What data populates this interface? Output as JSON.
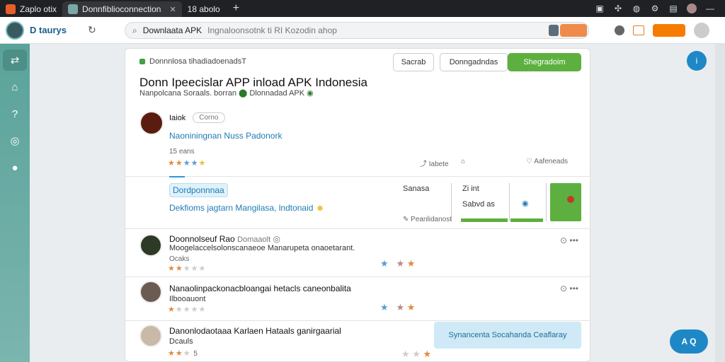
{
  "tabs": [
    {
      "label": "Zaplo otix",
      "active": false
    },
    {
      "label": "Donnfiblioconnection",
      "active": true
    },
    {
      "label": "18 abolo",
      "active": false
    }
  ],
  "toolbar": {
    "app_name": "D taurys",
    "omnibox_query": "Downlaata APK",
    "omnibox_rest": "Ingnaloonsotnk ti RI Kozodin ahop"
  },
  "breadcrumb": "Donnnlosa tihadiadoenadsT",
  "buttons": {
    "secondary": "Sacrab",
    "outline": "Donngadndas",
    "primary": "Shegradoim"
  },
  "title": "Donn Ipeecislar APP inload APK Indonesia",
  "subtitle": "Nanpolcana Soraals. borran",
  "subtitle_link": "Dlonnadad APK",
  "author": {
    "name": "Iaiok",
    "chip": "Corno",
    "link": "Naoniningnan Nuss Padonork",
    "count": "15 eans"
  },
  "actions": {
    "share": "Iabete",
    "like": "Aafeneads"
  },
  "section": {
    "badge": "Dordponnnaa",
    "desc": "Dekfioms jagtarn Mangilasa, lndtonaid"
  },
  "stats": {
    "label": "Sanasa",
    "top_value": "Zi int",
    "value": "Sabvd as",
    "report": "Peanlidanost"
  },
  "reviews": [
    {
      "name": "Doonnolseuf Rao",
      "tag": "Domaaolt",
      "body": "Moogelaccelsolonscanaeoe Manarupeta onaoetarant.",
      "meta": "Ocaks"
    },
    {
      "name": "Nanaolinpackonacbloangai hetacls caneonbalita",
      "tag": "",
      "body": "Ilbooauont",
      "meta": ""
    },
    {
      "name": "Danonlodaotaaa Karlaen Hataals ganirgaarial",
      "tag": "",
      "body": "Dcauls",
      "meta": ""
    }
  ],
  "suggest": "Synancenta Socahanda Ceaflaray",
  "fab_bottom": "A Q",
  "colors": {
    "accent": "#5db03f",
    "link": "#1f7bb5",
    "rail": "#5aa39a"
  }
}
